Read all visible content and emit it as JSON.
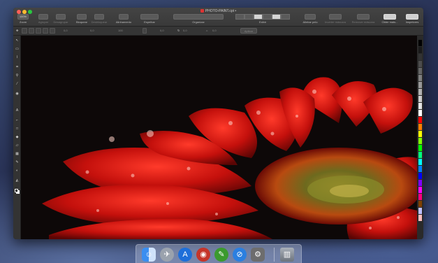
{
  "window": {
    "title": "PHOTO-PAINT.cpt",
    "title_modified": "•"
  },
  "toolbar": {
    "zoom_value": "100%",
    "zoom_label": "Zoom",
    "agrupar": "Agrupar",
    "desagrupar": "Desagrupar",
    "bloquear": "Bloquear",
    "desbloquear": "Desbloquear",
    "alinhamento": "Alinhamento",
    "espelhar": "Espelhar",
    "organizar": "Organizar",
    "exibir": "Exibir",
    "alinhar_pelo": "Alinhar pelo",
    "inverter_mascara": "Inverter máscara",
    "remover_mascara": "Remover máscara",
    "obter_mais": "Obter mais...",
    "inspetores": "Inspetores"
  },
  "propbar": {
    "x_value": "0,0",
    "y_value": "0,0",
    "w_value": "0,0",
    "h_value": "0,0",
    "pct1": "100",
    "pct2": "100",
    "angle": "0,0",
    "skew1": "0,0",
    "skew2": "0,0",
    "apply_label": "Aplicar"
  },
  "toolbox": {
    "tools": [
      "pick-tool",
      "mask-tool",
      "freehand-mask-tool",
      "crop-tool",
      "zoom-tool",
      "eyedropper-tool",
      "text-tool",
      "paint-tool",
      "effect-tool",
      "shape-tool",
      "fill-tool",
      "eraser-tool",
      "clone-tool",
      "brush-tool",
      "object-tool"
    ]
  },
  "palette": {
    "colors": [
      "#000000",
      "#1a1a1a",
      "#333333",
      "#4d4d4d",
      "#666666",
      "#808080",
      "#999999",
      "#b3b3b3",
      "#cccccc",
      "#e6e6e6",
      "#ffffff",
      "#ff0000",
      "#ff8000",
      "#ffff00",
      "#80ff00",
      "#00ff00",
      "#00ff80",
      "#00ffff",
      "#0080ff",
      "#0000ff",
      "#8000ff",
      "#ff00ff",
      "#ff0080",
      "#804000",
      "#c0c0ff",
      "#ffc0c0"
    ]
  },
  "dock": {
    "apps": [
      "finder",
      "launchpad",
      "app-store-a",
      "photo-paint",
      "corel-draw",
      "safari",
      "system-preferences"
    ],
    "trash": "trash"
  }
}
